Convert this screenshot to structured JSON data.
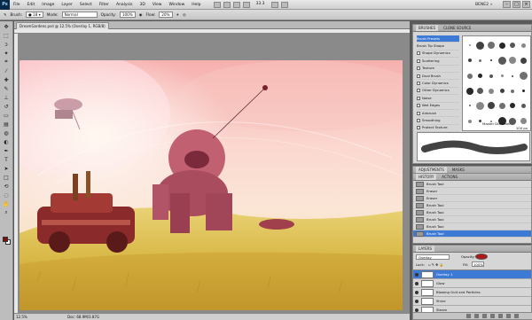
{
  "menubar": {
    "logo": "Ps",
    "items": [
      "File",
      "Edit",
      "Image",
      "Layer",
      "Select",
      "Filter",
      "Analysis",
      "3D",
      "View",
      "Window",
      "Help"
    ],
    "zoom": "33.3",
    "workspace": "BENE2"
  },
  "options": {
    "tool": "Brush:",
    "mode_label": "Mode:",
    "mode": "Normal",
    "opacity_label": "Opacity:",
    "opacity": "100%",
    "flow_label": "Flow:",
    "flow": "20%"
  },
  "doc": {
    "tab": "DreamGardens.psd @ 12.5% (Overlay 1, RGB/8)",
    "zoom": "12.5%",
    "info": "Doc: 68.9M/3.87G"
  },
  "brushes": {
    "tabs": [
      "BRUSHES",
      "CLONE SOURCE"
    ],
    "items": [
      "Brush Presets",
      "Brush Tip Shape",
      "Shape Dynamics",
      "Scattering",
      "Texture",
      "Dual Brush",
      "Color Dynamics",
      "Other Dynamics",
      "Noise",
      "Wet Edges",
      "Airbrush",
      "Smoothing",
      "Protect Texture"
    ],
    "master": "Master Diameter",
    "size": "100 px"
  },
  "adjust": {
    "tabs": [
      "ADJUSTMENTS",
      "MASKS"
    ]
  },
  "history": {
    "tabs": [
      "HISTORY",
      "ACTIONS"
    ],
    "items": [
      "Brush Tool",
      "Eraser",
      "Eraser",
      "Brush Tool",
      "Brush Tool",
      "Brush Tool",
      "Brush Tool",
      "Brush Tool"
    ]
  },
  "layers": {
    "tabs": [
      "LAYERS"
    ],
    "blend": "Overlay",
    "opacity_label": "Opacity:",
    "opacity": "100%",
    "lock_label": "Lock:",
    "fill_label": "Fill:",
    "fill": "100%",
    "items": [
      "Overlay 1",
      "Glow",
      "Blowing Guit and Particles",
      "Shine",
      "Steam"
    ]
  },
  "colors": {
    "accent": "#3d7ad6",
    "fg": "#7a1010",
    "bg": "#ffffff"
  }
}
